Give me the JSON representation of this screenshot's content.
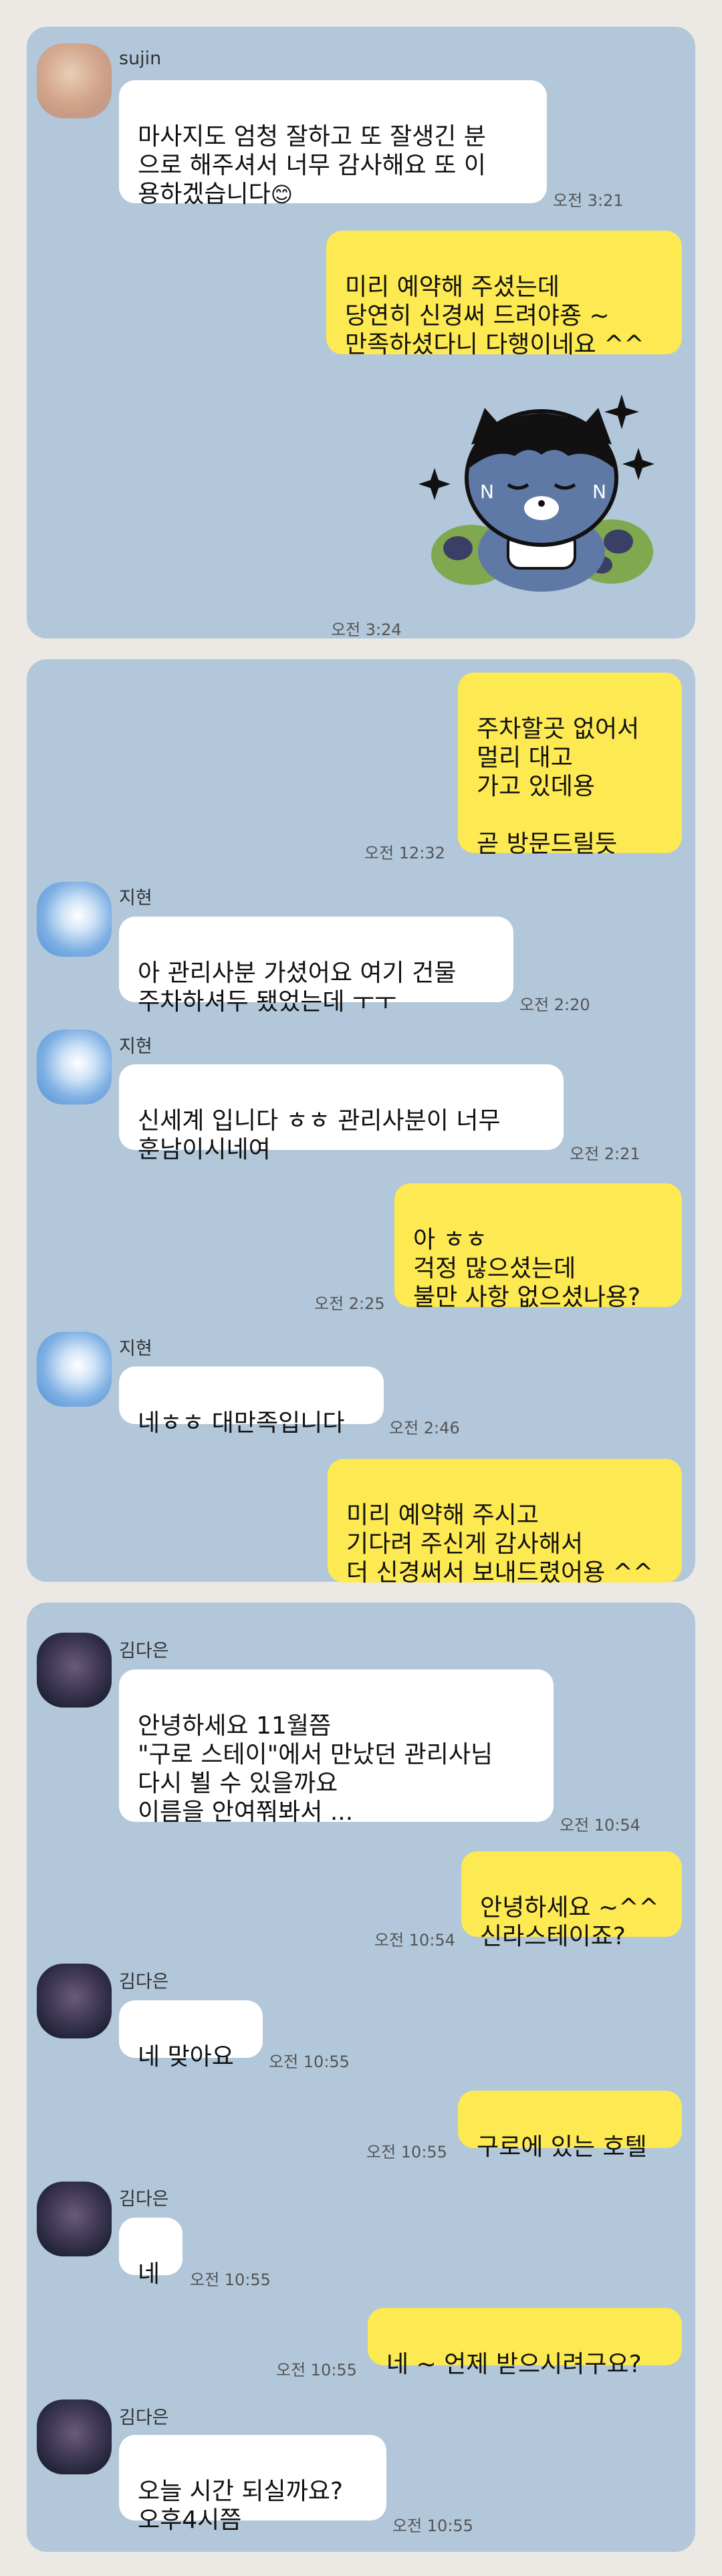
{
  "panels": [
    {
      "messages": [
        {
          "sender": "sujin",
          "text": "마사지도 엄청 잘하고 또 잘생긴 분\n으로 해주셔서 너무 감사해요 또 이\n용하겠습니다",
          "emoji": "😊",
          "time": "오전 3:21"
        },
        {
          "text": "미리 예약해 주셨는데\n당연히 신경써 드려야죵 ~\n만족하셨다니 다행이네요 ^^"
        },
        {
          "sticker": "ryan-sticker",
          "time": "오전 3:24"
        }
      ]
    },
    {
      "messages": [
        {
          "text": "주차할곳 없어서\n멀리 대고\n가고 있데용\n\n곧 방문드릴듯",
          "time": "오전 12:32"
        },
        {
          "sender": "지현",
          "text": "아 관리사분 가셨어요 여기 건물\n주차하셔두 됐었는데 ㅜㅜ",
          "time": "오전 2:20"
        },
        {
          "sender": "지현",
          "text": "신세계 입니다 ㅎㅎ 관리사분이 너무\n훈남이시네여",
          "time": "오전 2:21"
        },
        {
          "text": "아 ㅎㅎ\n걱정 많으셨는데\n불만 사항 없으셨나용?",
          "time": "오전 2:25"
        },
        {
          "sender": "지현",
          "text": "네ㅎㅎ 대만족입니다",
          "time": "오전 2:46"
        },
        {
          "text": "미리 예약해 주시고\n기다려 주신게 감사해서\n더 신경써서 보내드렸어용 ^^"
        }
      ]
    },
    {
      "messages": [
        {
          "sender": "김다은",
          "text": "안녕하세요 11월쯤\n\"구로 스테이\"에서 만났던 관리사님\n다시 뵐 수 있을까요\n이름을 안여쭤봐서 ...",
          "time": "오전 10:54"
        },
        {
          "text": "안녕하세요 ~^^\n신라스테이죠?",
          "time": "오전 10:54"
        },
        {
          "sender": "김다은",
          "text": "네 맞아요",
          "time": "오전 10:55"
        },
        {
          "text": "구로에 있는 호텔",
          "time": "오전 10:55"
        },
        {
          "sender": "김다은",
          "text": "네",
          "time": "오전 10:55"
        },
        {
          "text": "네 ~ 언제 받으시려구요?",
          "time": "오전 10:55"
        },
        {
          "sender": "김다은",
          "text": "오늘  시간 되실까요?\n오후4시쯤",
          "time": "오전 10:55"
        }
      ]
    }
  ]
}
